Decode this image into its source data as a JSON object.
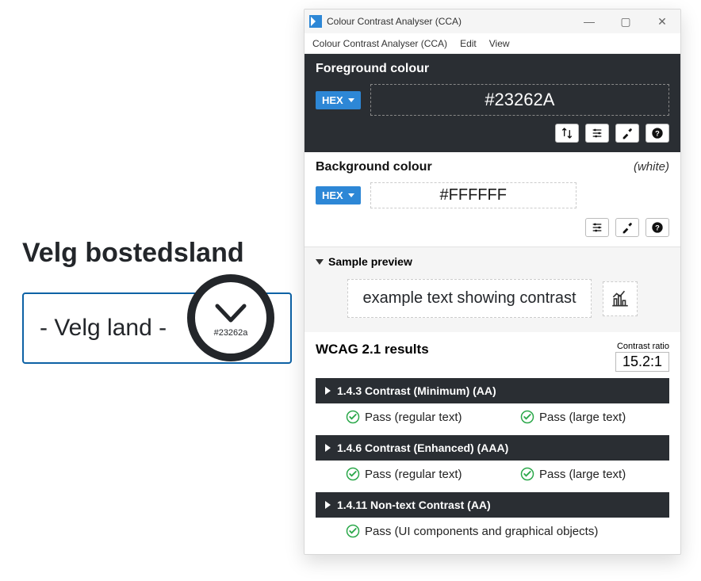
{
  "left": {
    "title": "Velg bostedsland",
    "select_placeholder": "- Velg land -",
    "magnifier_label": "#23262a"
  },
  "app": {
    "window_title": "Colour Contrast Analyser (CCA)",
    "menus": {
      "m1": "Colour Contrast Analyser (CCA)",
      "m2": "Edit",
      "m3": "View"
    },
    "foreground": {
      "title": "Foreground colour",
      "format": "HEX",
      "value": "#23262A"
    },
    "background": {
      "title": "Background colour",
      "hint": "(white)",
      "format": "HEX",
      "value": "#FFFFFF"
    },
    "sample": {
      "title": "Sample preview",
      "text": "example text showing contrast"
    },
    "results": {
      "title": "WCAG 2.1 results",
      "ratio_label": "Contrast ratio",
      "ratio_value": "15.2:1",
      "c1": {
        "title": "1.4.3 Contrast (Minimum) (AA)",
        "p1": "Pass (regular text)",
        "p2": "Pass (large text)"
      },
      "c2": {
        "title": "1.4.6 Contrast (Enhanced) (AAA)",
        "p1": "Pass (regular text)",
        "p2": "Pass (large text)"
      },
      "c3": {
        "title": "1.4.11 Non-text Contrast (AA)",
        "p1": "Pass (UI components and graphical objects)"
      }
    }
  }
}
